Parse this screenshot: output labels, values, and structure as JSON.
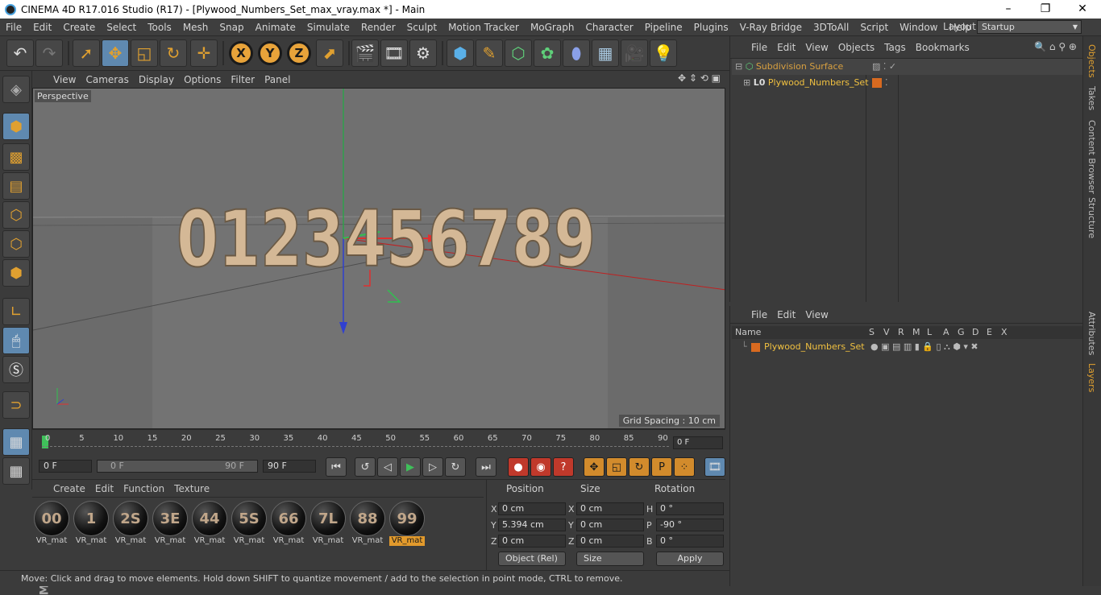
{
  "window": {
    "title": "CINEMA 4D R17.016 Studio (R17) - [Plywood_Numbers_Set_max_vray.max *] - Main",
    "minimize": "–",
    "maximize": "❐",
    "close": "✕"
  },
  "menubar": {
    "items": [
      "File",
      "Edit",
      "Create",
      "Select",
      "Tools",
      "Mesh",
      "Snap",
      "Animate",
      "Simulate",
      "Render",
      "Sculpt",
      "Motion Tracker",
      "MoGraph",
      "Character",
      "Pipeline",
      "Plugins",
      "V-Ray Bridge",
      "3DToAll",
      "Script",
      "Window",
      "Help"
    ],
    "layout_label": "Layout:",
    "layout_value": "Startup"
  },
  "toolbar": {
    "icons": [
      "undo-icon",
      "redo-icon",
      "select-cursor-icon",
      "move-icon",
      "scale-icon",
      "rotate-icon",
      "move-arrows-icon",
      "x-axis-icon",
      "y-axis-icon",
      "z-axis-icon",
      "coordinate-system-icon",
      "render-view-icon",
      "render-picture-icon",
      "render-settings-icon",
      "cube-icon",
      "pen-spline-icon",
      "subdivision-icon",
      "cloner-icon",
      "deformer-icon",
      "floor-icon",
      "camera-icon",
      "light-icon"
    ],
    "axis_x": "X",
    "axis_y": "Y",
    "axis_z": "Z"
  },
  "viewport": {
    "menu": [
      "View",
      "Cameras",
      "Display",
      "Options",
      "Filter",
      "Panel"
    ],
    "label": "Perspective",
    "grid_spacing": "Grid Spacing : 10 cm",
    "numbers_text": "0123456789"
  },
  "timeline": {
    "ticks": [
      "0",
      "5",
      "10",
      "15",
      "20",
      "25",
      "30",
      "35",
      "40",
      "45",
      "50",
      "55",
      "60",
      "65",
      "70",
      "75",
      "80",
      "85",
      "90"
    ],
    "current_frame": "0 F"
  },
  "animation": {
    "start_field": "0 F",
    "range_start": "0 F",
    "range_end": "90 F",
    "end_field": "90 F"
  },
  "material_manager": {
    "menu": [
      "Create",
      "Edit",
      "Function",
      "Texture"
    ],
    "materials": [
      {
        "label": "VR_mat",
        "glyph": "00"
      },
      {
        "label": "VR_mat",
        "glyph": "1"
      },
      {
        "label": "VR_mat",
        "glyph": "2S"
      },
      {
        "label": "VR_mat",
        "glyph": "3E"
      },
      {
        "label": "VR_mat",
        "glyph": "44"
      },
      {
        "label": "VR_mat",
        "glyph": "5S"
      },
      {
        "label": "VR_mat",
        "glyph": "66"
      },
      {
        "label": "VR_mat",
        "glyph": "7L"
      },
      {
        "label": "VR_mat",
        "glyph": "88"
      },
      {
        "label": "VR_mat",
        "glyph": "99",
        "selected": true
      }
    ]
  },
  "coordinates": {
    "headers": {
      "position": "Position",
      "size": "Size",
      "rotation": "Rotation"
    },
    "rows": [
      {
        "pos_axis": "X",
        "pos": "0 cm",
        "size_axis": "X",
        "size": "0 cm",
        "rot_axis": "H",
        "rot": "0 °"
      },
      {
        "pos_axis": "Y",
        "pos": "5.394 cm",
        "size_axis": "Y",
        "size": "0 cm",
        "rot_axis": "P",
        "rot": "-90 °"
      },
      {
        "pos_axis": "Z",
        "pos": "0 cm",
        "size_axis": "Z",
        "size": "0 cm",
        "rot_axis": "B",
        "rot": "0 °"
      }
    ],
    "mode_select": "Object (Rel)",
    "size_select": "Size",
    "apply": "Apply"
  },
  "status": {
    "text": "Move: Click and drag to move elements. Hold down SHIFT to quantize movement / add to the selection in point mode, CTRL to remove."
  },
  "object_manager": {
    "menu": [
      "File",
      "Edit",
      "View",
      "Objects",
      "Tags",
      "Bookmarks"
    ],
    "objects": [
      {
        "name": "Subdivision Surface",
        "color": "#d8a040"
      },
      {
        "name": "Plywood_Numbers_Set",
        "color": "#f0c040"
      }
    ]
  },
  "layer_manager": {
    "menu": [
      "File",
      "Edit",
      "View"
    ],
    "columns": [
      "Name",
      "S",
      "V",
      "R",
      "M",
      "L",
      "A",
      "G",
      "D",
      "E",
      "X"
    ],
    "layers": [
      {
        "name": "Plywood_Numbers_Set",
        "color": "#d86a20"
      }
    ]
  },
  "right_dock": {
    "tabs": [
      "Objects",
      "Takes",
      "Content Browser",
      "Structure",
      "Attributes",
      "Layers"
    ]
  },
  "colors": {
    "accent": "#e0a030",
    "active_tool": "#5f89b0",
    "viewport_bg": "#6e6e6e",
    "panel_bg": "#3b3b3b"
  }
}
